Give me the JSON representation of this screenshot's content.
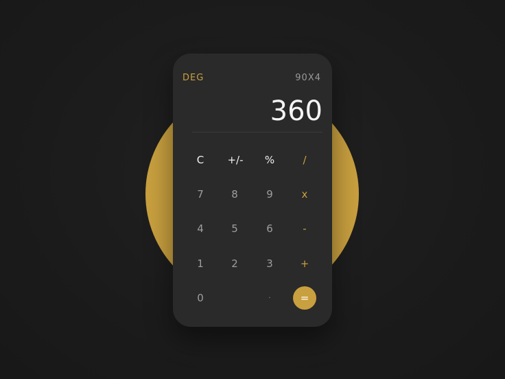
{
  "display": {
    "mode": "DEG",
    "expression": "90X4",
    "result": "360"
  },
  "keys": {
    "clear": "C",
    "sign": "+/-",
    "percent": "%",
    "divide": "/",
    "seven": "7",
    "eight": "8",
    "nine": "9",
    "multiply": "x",
    "four": "4",
    "five": "5",
    "six": "6",
    "minus": "-",
    "one": "1",
    "two": "2",
    "three": "3",
    "plus": "+",
    "zero": "0",
    "decimal": "·",
    "equals": "="
  },
  "colors": {
    "accent": "#c9a03f",
    "card": "#2a2a2a",
    "background": "#1b1b1b"
  }
}
